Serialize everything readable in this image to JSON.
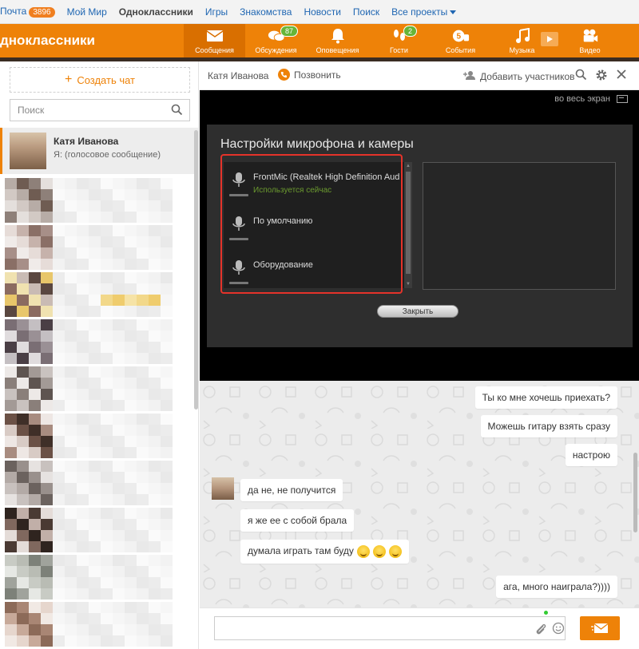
{
  "portal": {
    "mail_label": "Почта",
    "mail_count": "3896",
    "my_world": "Мой Мир",
    "odnoklassniki": "Одноклассники",
    "games": "Игры",
    "dating": "Знакомства",
    "news": "Новости",
    "search": "Поиск",
    "all_projects": "Все проекты"
  },
  "nav": {
    "logo": "дноклассники",
    "items": [
      {
        "label": "Сообщения",
        "icon": "envelope-icon",
        "badge": ""
      },
      {
        "label": "Обсуждения",
        "icon": "discussions-icon",
        "badge": "87"
      },
      {
        "label": "Оповещения",
        "icon": "bell-icon",
        "badge": ""
      },
      {
        "label": "Гости",
        "icon": "footprints-icon",
        "badge": "2"
      },
      {
        "label": "События",
        "icon": "events-icon",
        "badge": ""
      },
      {
        "label": "Музыка",
        "icon": "music-note-icon",
        "badge": ""
      },
      {
        "label": "Видео",
        "icon": "video-camera-icon",
        "badge": ""
      }
    ]
  },
  "sidebar": {
    "create_chat": "Создать чат",
    "search_placeholder": "Поиск",
    "active_chat": {
      "name": "Катя Иванова",
      "preview": "Я:  (голосовое сообщение)"
    }
  },
  "chat_header": {
    "name": "Катя Иванова",
    "call": "Позвонить",
    "add_participants": "Добавить участников"
  },
  "video": {
    "fullscreen": "во весь экран",
    "settings_title": "Настройки микрофона и камеры",
    "devices": [
      {
        "name": "FrontMic (Realtek High Definition Aud",
        "status": "Используется сейчас"
      },
      {
        "name": "По умолчанию",
        "status": ""
      },
      {
        "name": "Оборудование",
        "status": ""
      }
    ],
    "close": "Закрыть"
  },
  "messages": [
    {
      "from": "me",
      "text": "Ты ко мне хочешь приехать?"
    },
    {
      "from": "me",
      "text": "Можешь гитару взять сразу"
    },
    {
      "from": "me",
      "text": "настрою"
    },
    {
      "from": "them",
      "text": "да не, не получится"
    },
    {
      "from": "them",
      "text": "я же ее с собой брала"
    },
    {
      "from": "them",
      "text": "думала играть там буду",
      "emoji_count": 3
    },
    {
      "from": "me",
      "text": "ага, много наиграла?))))"
    }
  ],
  "colors": {
    "accent": "#ee8208",
    "portal_link": "#1f66b2",
    "highlight": "#e5332a",
    "badge_green": "#66b537"
  }
}
